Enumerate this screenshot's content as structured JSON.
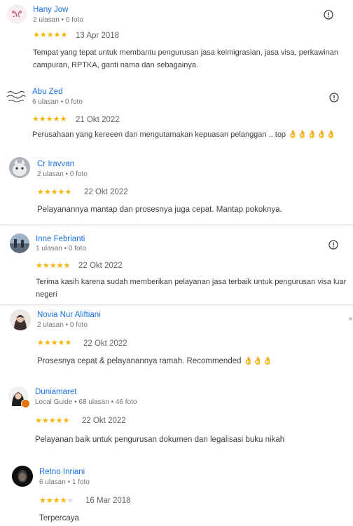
{
  "reviews": [
    {
      "name": "Hany Jow",
      "meta": "2 ulasan • 0 foto",
      "rating": 5,
      "date": "13 Apr 2018",
      "text": "Tempat yang tepat untuk membantu pengurusan jasa keimigrasian, jasa visa, perkawinan campuran, RPTKA, ganti nama dan sebagainya.",
      "avatar": "avatar-logo"
    },
    {
      "name": "Abu Zed",
      "meta": "6 ulasan • 0 foto",
      "rating": 5,
      "date": "21 Okt 2022",
      "text": "Perusahaan yang kereeen dan mengutamakan kepuasan pelanggan .. top",
      "emoji": "👌👌👌👌👌",
      "avatar": "avatar-calligraphy"
    },
    {
      "name": "Cr Iravvan",
      "meta": "2 ulasan • 0 foto",
      "rating": 5,
      "date": "22 Okt 2022",
      "text": "Pelayanannya mantap dan prosesnya juga cepat. Mantap pokoknya.",
      "avatar": "avatar-cat"
    },
    {
      "name": "Inne Febrianti",
      "meta": "1 ulasan • 0 foto",
      "rating": 5,
      "date": "22 Okt 2022",
      "text": "Terima kasih karena sudah memberikan pelayanan jasa terbaik untuk pengurusan visa luar negeri",
      "avatar": "avatar-photo"
    },
    {
      "name": "Novia Nur Aliftiani",
      "meta": "2 ulasan • 0 foto",
      "rating": 5,
      "date": "22 Okt 2022",
      "text": "Prosesnya cepat & pelayanannya ramah. Recommended",
      "emoji": "👌👌👌",
      "avatar": "avatar-person"
    },
    {
      "name": "Duniamaret",
      "meta": "Local Guide • 68 ulasan • 46 foto",
      "rating": 5,
      "date": "22 Okt 2022",
      "text": "Pelayanan baik untuk pengurusan dokumen dan legalisasi buku nikah",
      "avatar": "avatar-guide"
    },
    {
      "name": "Retno Inriani",
      "meta": "6 ulasan • 1 foto",
      "rating": 4,
      "date": "16 Mar 2018",
      "text": "Terpercaya",
      "avatar": "avatar-dark"
    }
  ],
  "icons": {
    "report": "flag-report-icon",
    "star": "star-icon"
  },
  "colors": {
    "link": "#1a73e8",
    "star": "#f4b400",
    "star_off": "#dadce0"
  }
}
